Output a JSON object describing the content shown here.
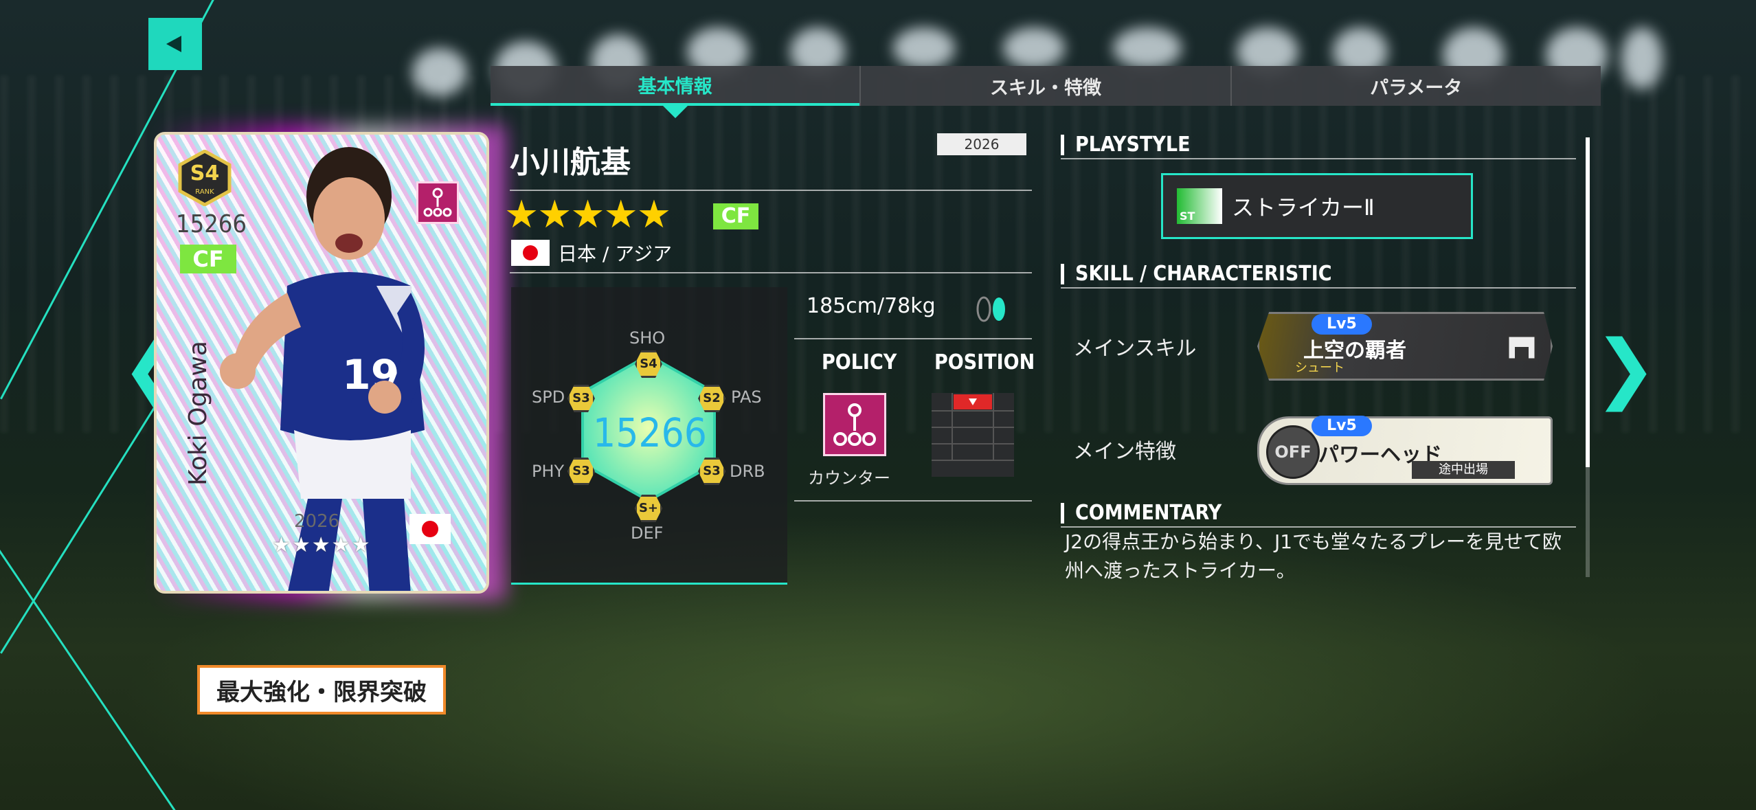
{
  "tabs": [
    "基本情報",
    "スキル・特徴",
    "パラメータ"
  ],
  "card": {
    "rank": "S4",
    "rank_label": "RANK",
    "overall": "15266",
    "position": "CF",
    "name": "Koki Ogawa",
    "year": "2026",
    "stars": "★★★★★"
  },
  "enhance_button": "最大強化・限界突破",
  "player": {
    "name": "小川航基",
    "year": "2026",
    "stars": "★★★★★",
    "position": "CF",
    "nationality": "日本 / アジア",
    "height_weight": "185cm/78kg"
  },
  "stats": {
    "total": "15266",
    "labels": {
      "sho": "SHO",
      "pas": "PAS",
      "drb": "DRB",
      "def": "DEF",
      "phy": "PHY",
      "spd": "SPD"
    },
    "ranks": {
      "sho": "S4",
      "pas": "S2",
      "drb": "S3",
      "def": "S+",
      "phy": "S3",
      "spd": "S3"
    }
  },
  "policy": {
    "header": "POLICY",
    "label": "カウンター"
  },
  "position_header": "POSITION",
  "sections": {
    "playstyle": "PLAYSTYLE",
    "skill": "SKILL / CHARACTERISTIC",
    "commentary": "COMMENTARY"
  },
  "playstyle": {
    "badge": "ST",
    "name": "ストライカーⅡ"
  },
  "main_skill": {
    "label": "メインスキル",
    "level": "Lv5",
    "name": "上空の覇者",
    "category": "シュート"
  },
  "main_trait": {
    "label": "メイン特徴",
    "level": "Lv5",
    "name": "パワーヘッド",
    "status": "OFF",
    "condition": "途中出場"
  },
  "commentary_text": "J2の得点王から始まり、J1でも堂々たるプレーを見せて欧州へ渡ったストライカー。",
  "colors": {
    "accent": "#26e6c8",
    "position": "#7ee640",
    "star": "#ffd000",
    "policy": "#b4206a",
    "enhance_border": "#f08a2a"
  },
  "icons": [
    "back-icon",
    "prev-arrow-icon",
    "next-arrow-icon",
    "feet-icon",
    "policy-counter-icon",
    "goal-icon",
    "striker-icon"
  ]
}
